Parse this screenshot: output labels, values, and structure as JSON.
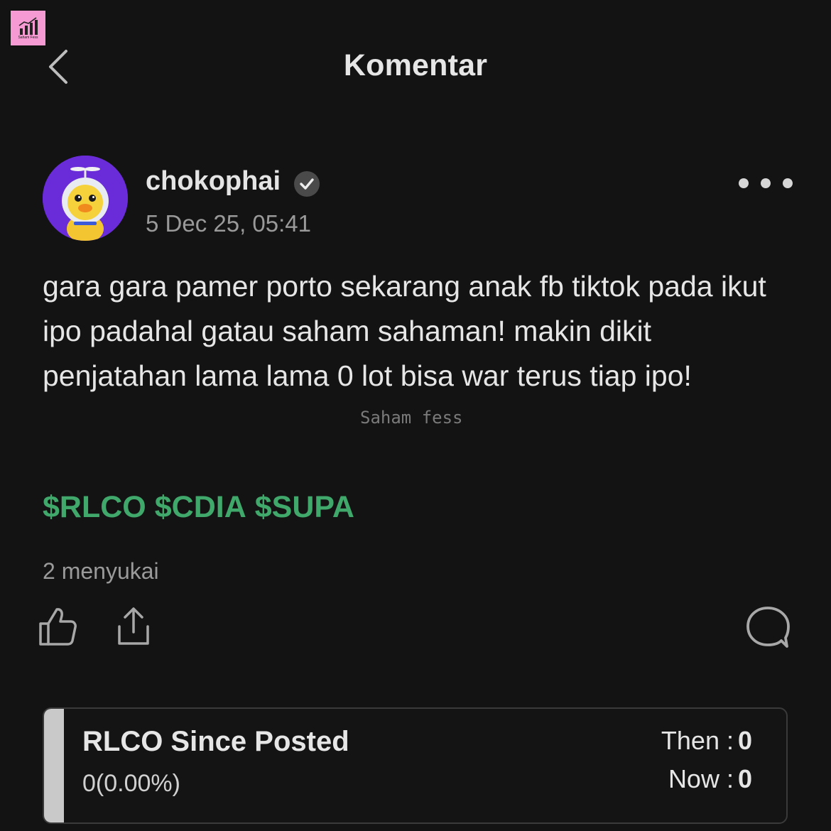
{
  "header": {
    "title": "Komentar",
    "logo_text": "Saham Fess"
  },
  "post": {
    "username": "chokophai",
    "timestamp": "5 Dec 25, 05:41",
    "body": "gara gara pamer porto sekarang anak fb tiktok pada ikut ipo padahal gatau saham sahaman! makin dikit penjatahan lama lama 0 lot bisa war terus tiap ipo!",
    "tickers": [
      "$RLCO",
      "$CDIA",
      "$SUPA"
    ],
    "likes": "2 menyukai",
    "watermark": "Saham fess"
  },
  "price_card": {
    "title": "RLCO Since Posted",
    "change": "0(0.00%)",
    "then_label": "Then :",
    "then_value": "0",
    "now_label": "Now :",
    "now_value": "0"
  },
  "colors": {
    "background": "#131313",
    "ticker_green": "#3fa86a",
    "avatar_purple": "#6a2bd9",
    "logo_pink": "#f59ad2"
  },
  "icons": {
    "back": "chevron-left-icon",
    "verified": "verified-check-icon",
    "more": "more-dots-icon",
    "like": "thumbs-up-icon",
    "share": "share-icon",
    "comment": "comment-bubble-icon"
  }
}
